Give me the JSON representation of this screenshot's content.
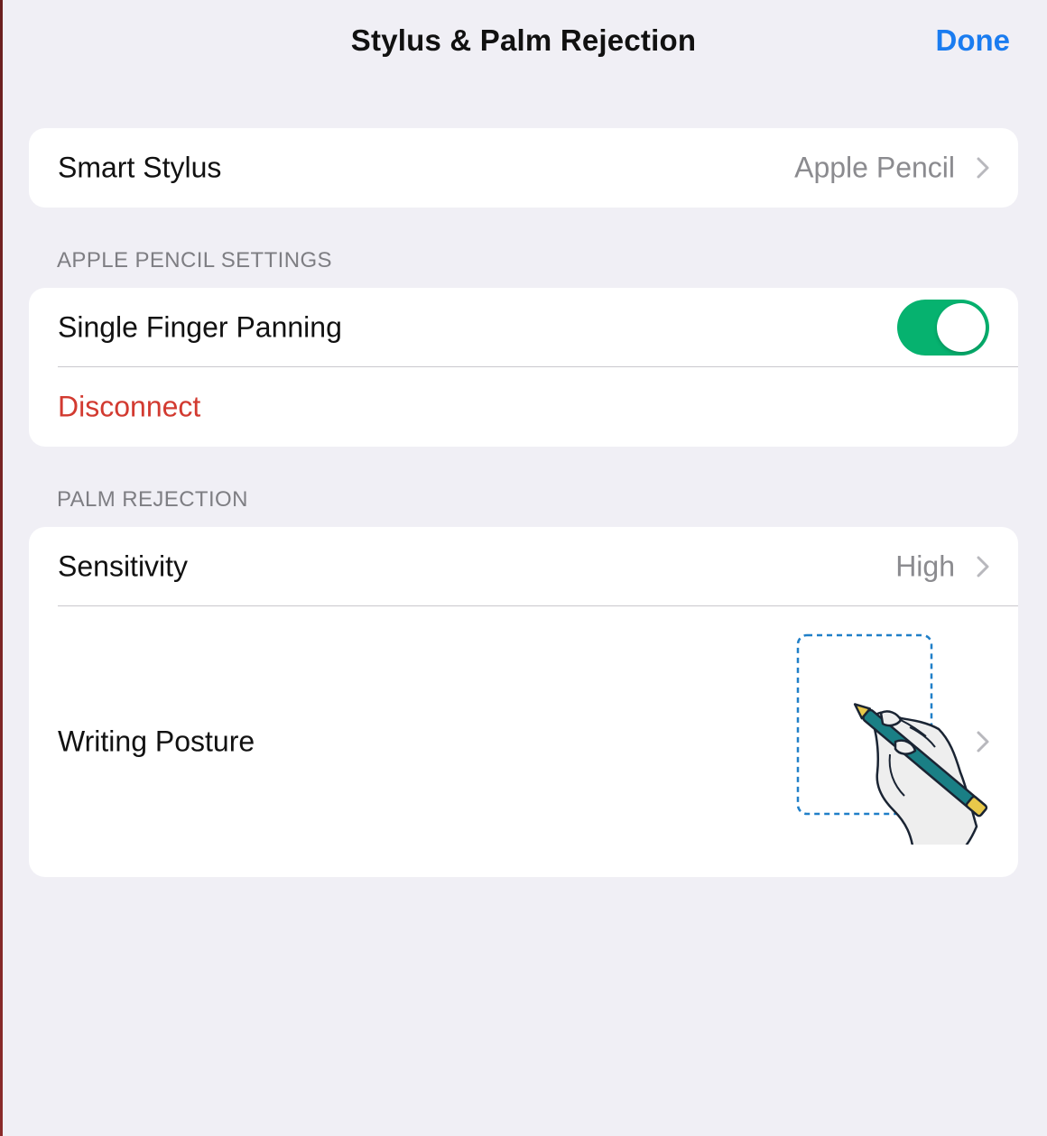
{
  "nav": {
    "title": "Stylus & Palm Rejection",
    "done_label": "Done"
  },
  "smart_stylus": {
    "label": "Smart Stylus",
    "value": "Apple Pencil"
  },
  "apple_pencil_settings": {
    "header": "APPLE PENCIL SETTINGS",
    "single_finger_panning": {
      "label": "Single Finger Panning",
      "enabled": true
    },
    "disconnect_label": "Disconnect"
  },
  "palm_rejection": {
    "header": "PALM REJECTION",
    "sensitivity": {
      "label": "Sensitivity",
      "value": "High"
    },
    "writing_posture": {
      "label": "Writing Posture"
    }
  },
  "colors": {
    "accent": "#1a7cf0",
    "toggle_on": "#06b26f",
    "destructive": "#d23a30",
    "background": "#f0eff5"
  },
  "icons": {
    "chevron": "chevron-right-icon",
    "posture": "hand-holding-pencil-illustration"
  }
}
